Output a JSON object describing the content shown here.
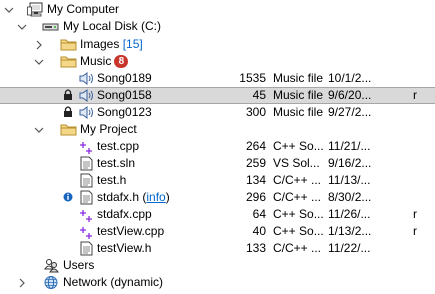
{
  "tree": [
    {
      "name": "My Computer",
      "icon": "computer-icon"
    },
    {
      "name": "My Local Disk (C:)",
      "icon": "disk-icon"
    },
    {
      "name": "Images",
      "count": "[15]",
      "icon": "folder-icon"
    },
    {
      "name": "Music",
      "badge": "8",
      "icon": "folder-icon"
    },
    {
      "name": "Song0189",
      "size": "1535",
      "type": "Music file",
      "date": "10/1/2...",
      "attr": "",
      "icon": "speaker-icon"
    },
    {
      "name": "Song0158",
      "size": "45",
      "type": "Music file",
      "date": "9/6/20...",
      "attr": "r",
      "icon": "speaker-icon",
      "prefix": "lock-icon"
    },
    {
      "name": "Song0123",
      "size": "300",
      "type": "Music file",
      "date": "9/27/2...",
      "attr": "",
      "icon": "speaker-icon",
      "prefix": "lock-icon"
    },
    {
      "name": "My Project",
      "icon": "folder-icon"
    },
    {
      "name": "test.cpp",
      "size": "264",
      "type": "C++ So...",
      "date": "11/21/...",
      "attr": "",
      "icon": "cpp-icon"
    },
    {
      "name": "test.sln",
      "size": "259",
      "type": "VS Sol...",
      "date": "9/16/2...",
      "attr": "",
      "icon": "document-icon"
    },
    {
      "name": "test.h",
      "size": "134",
      "type": "C/C++ ...",
      "date": "11/13/...",
      "attr": "",
      "icon": "document-icon"
    },
    {
      "name": "stdafx.h",
      "link": "info",
      "size": "296",
      "type": "C/C++ ...",
      "date": "8/30/2...",
      "attr": "",
      "icon": "document-icon",
      "prefix": "info-icon"
    },
    {
      "name": "stdafx.cpp",
      "size": "64",
      "type": "C++ So...",
      "date": "11/26/...",
      "attr": "r",
      "icon": "cpp-icon"
    },
    {
      "name": "testView.cpp",
      "size": "40",
      "type": "C++ So...",
      "date": "1/13/2...",
      "attr": "r",
      "icon": "cpp-icon"
    },
    {
      "name": "testView.h",
      "size": "133",
      "type": "C/C++ ...",
      "date": "11/22/...",
      "attr": "",
      "icon": "document-icon"
    },
    {
      "name": "Users",
      "icon": "users-icon"
    },
    {
      "name": "Network (dynamic)",
      "icon": "globe-icon"
    }
  ],
  "colors": {
    "selection": "#d9d9d9",
    "link": "#0066cc",
    "badge": "#c8352b",
    "folder": "#e8c264"
  }
}
